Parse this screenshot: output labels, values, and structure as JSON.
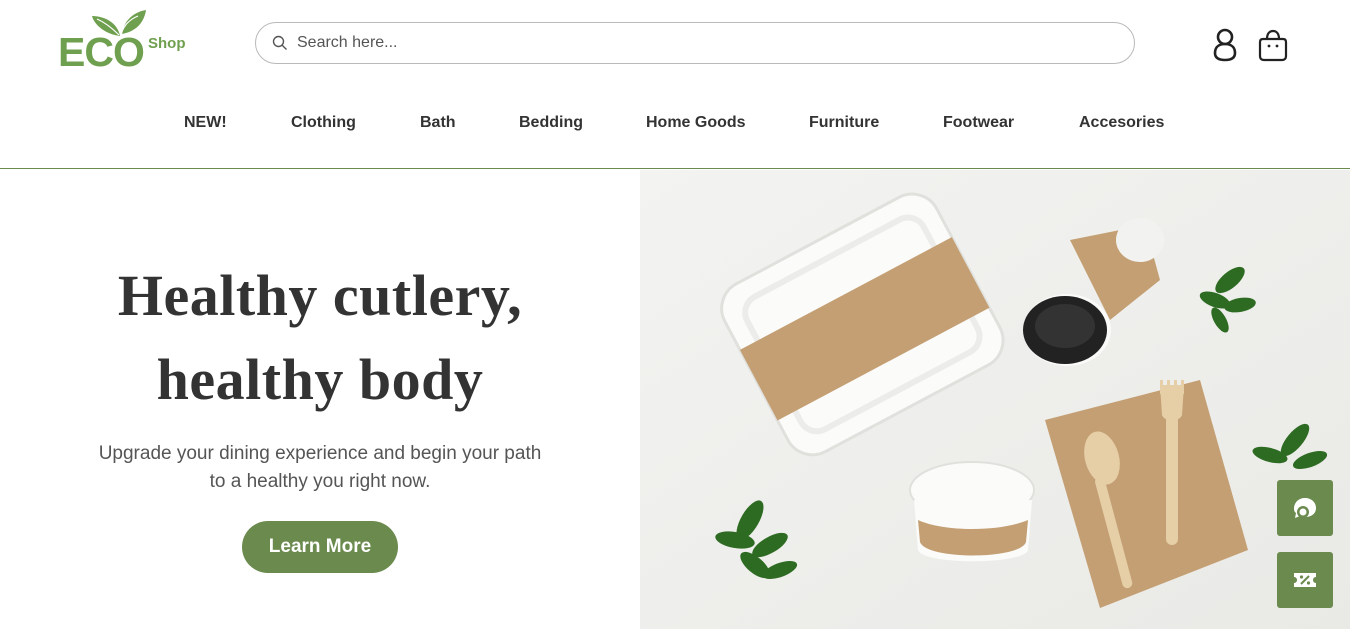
{
  "brand": {
    "logo_text": "ECO",
    "logo_sub": "Shop",
    "color": "#6fa04f"
  },
  "search": {
    "placeholder": "Search here...",
    "value": ""
  },
  "header_icons": {
    "account": "user-icon",
    "cart": "shopping-bag-icon"
  },
  "nav": {
    "items": [
      {
        "label": "NEW!"
      },
      {
        "label": "Clothing"
      },
      {
        "label": "Bath"
      },
      {
        "label": "Bedding"
      },
      {
        "label": "Home Goods"
      },
      {
        "label": "Furniture"
      },
      {
        "label": "Footwear"
      },
      {
        "label": "Accesories"
      }
    ]
  },
  "hero": {
    "title_line1": "Healthy cutlery,",
    "title_line2": "healthy body",
    "subtitle": "Upgrade your dining experience and begin your path to a healthy you right now.",
    "button_label": "Learn More",
    "image": "eco-friendly-tableware-photo"
  },
  "floating": {
    "chat_icon": "chat-bubbles-icon",
    "discount_icon": "discount-ticket-icon"
  },
  "colors": {
    "accent": "#6b8a4e",
    "text": "#333333",
    "muted": "#555555",
    "border": "#b9b9b9"
  }
}
